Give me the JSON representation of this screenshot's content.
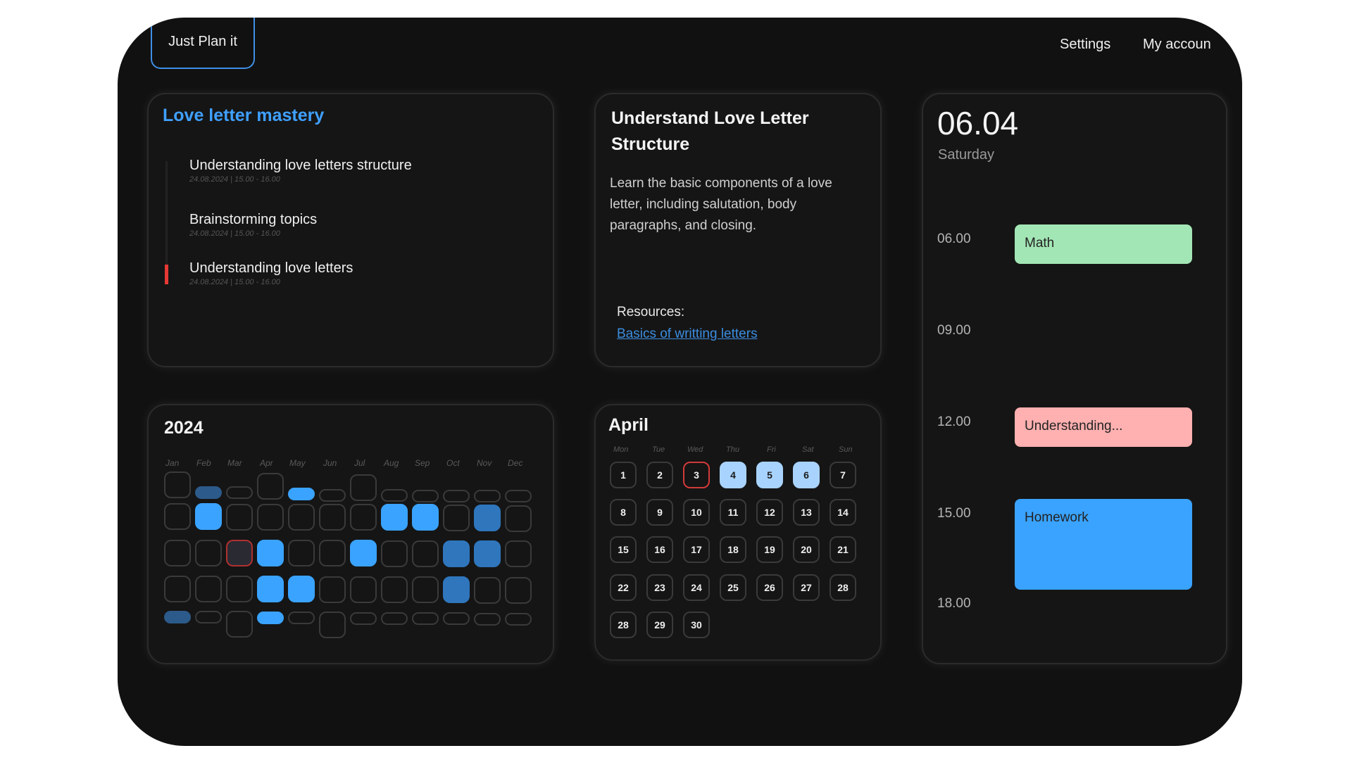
{
  "brand": "Just Plan it",
  "nav": {
    "settings": "Settings",
    "account": "My accoun"
  },
  "goal": {
    "title": "Love letter mastery",
    "tasks": [
      {
        "title": "Understanding love letters structure",
        "date": "24.08.2024 | 15.00 - 16.00"
      },
      {
        "title": "Brainstorming topics",
        "date": "24.08.2024 | 15.00 - 16.00"
      },
      {
        "title": "Understanding love letters",
        "date": "24.08.2024 | 15.00 - 16.00"
      }
    ]
  },
  "detail": {
    "title": "Understand Love Letter Structure",
    "description": "Learn the basic components of a love letter, including salutation, body paragraphs, and closing.",
    "resources_label": "Resources:",
    "resource_link": "Basics of writting letters"
  },
  "year": {
    "title": "2024",
    "months": [
      "Jan",
      "Feb",
      "Mar",
      "Apr",
      "May",
      "Jun",
      "Jul",
      "Aug",
      "Sep",
      "Oct",
      "Nov",
      "Dec"
    ]
  },
  "month": {
    "title": "April",
    "weekdays": [
      "Mon",
      "Tue",
      "Wed",
      "Thu",
      "Fri",
      "Sat",
      "Sun"
    ],
    "days": [
      "1",
      "2",
      "3",
      "4",
      "5",
      "6",
      "7",
      "8",
      "9",
      "10",
      "11",
      "12",
      "13",
      "14",
      "15",
      "16",
      "17",
      "18",
      "19",
      "20",
      "21",
      "22",
      "23",
      "24",
      "25",
      "26",
      "27",
      "28",
      "28",
      "29",
      "30"
    ],
    "today": "3",
    "highlighted": [
      "4",
      "5",
      "6"
    ]
  },
  "schedule": {
    "date": "06.04",
    "weekday": "Saturday",
    "times": [
      "06.00",
      "09.00",
      "12.00",
      "15.00",
      "18.00"
    ],
    "events": [
      {
        "label": "Math",
        "color": "#a3e6b5"
      },
      {
        "label": "Understanding...",
        "color": "#ffb0b0"
      },
      {
        "label": "Homework",
        "color": "#3aa3ff"
      }
    ]
  },
  "colors": {
    "accent": "#3fa0ff",
    "background": "#111111",
    "card": "#151515",
    "marker": "#e53935"
  }
}
